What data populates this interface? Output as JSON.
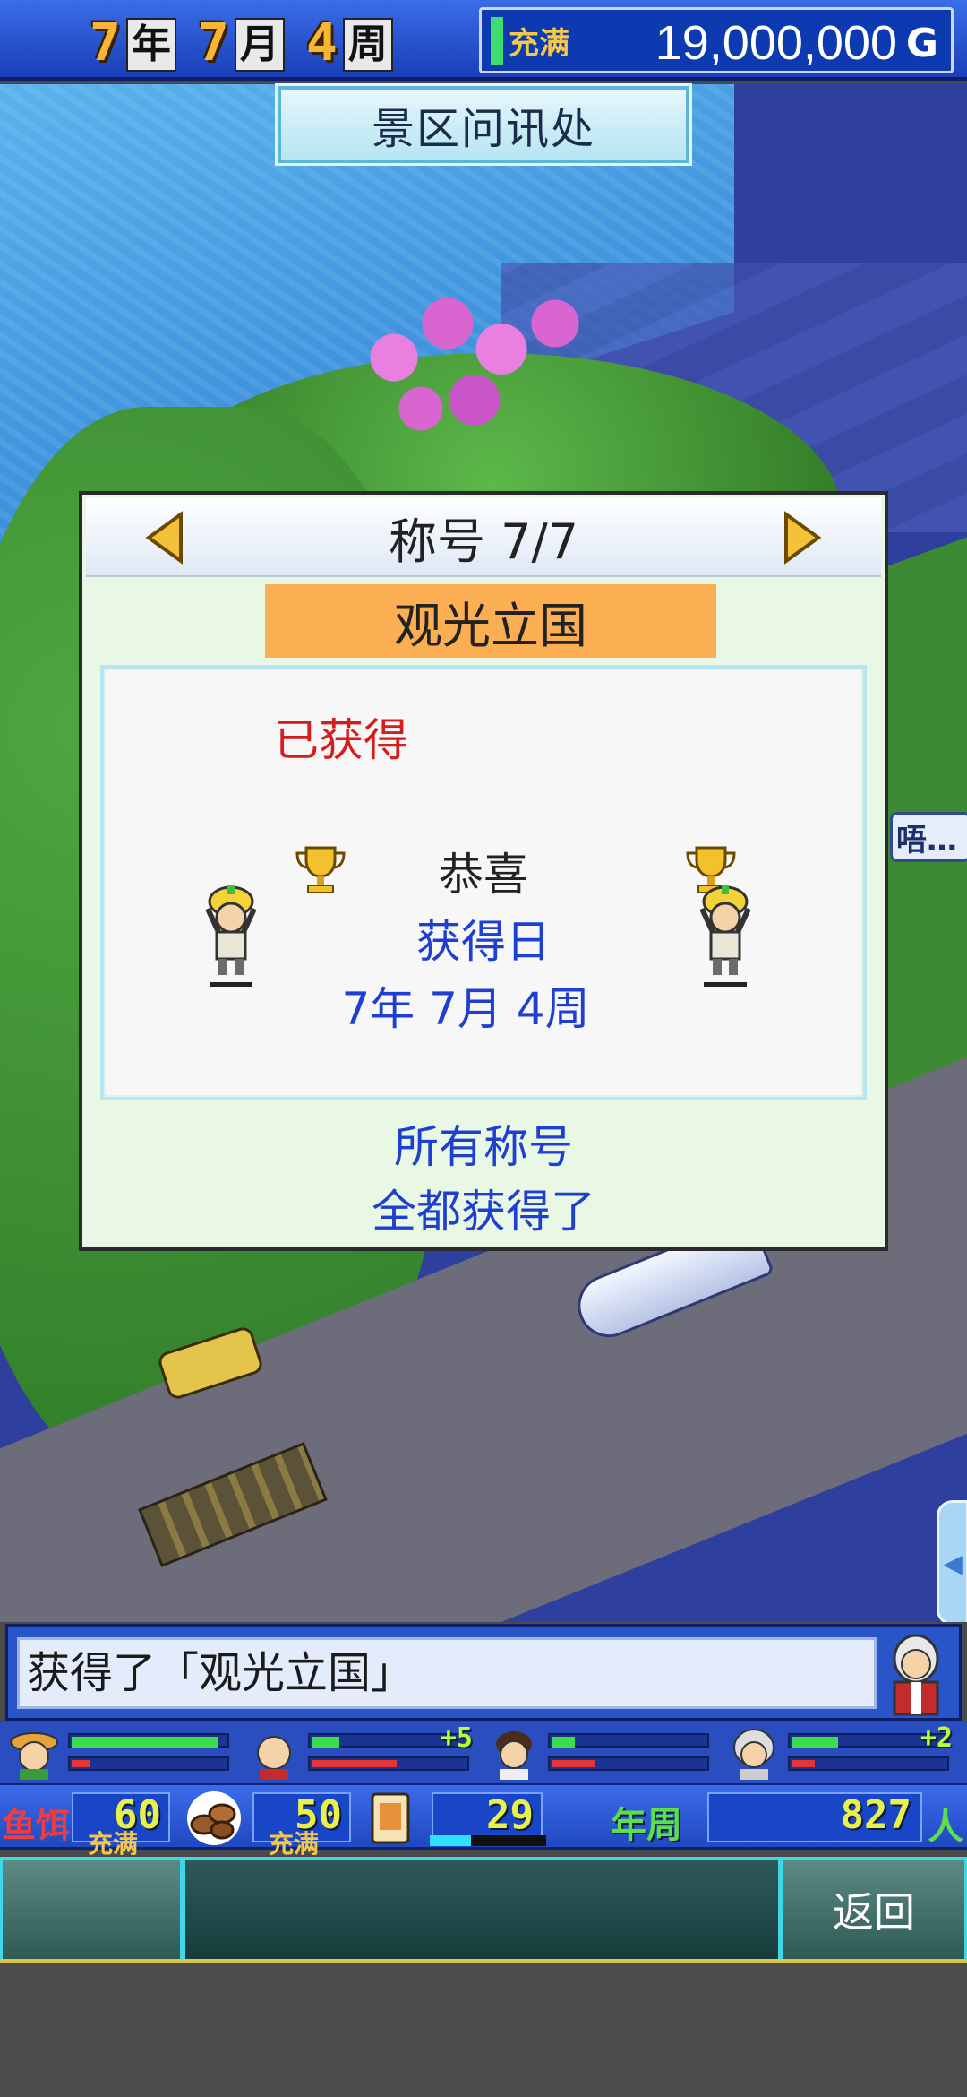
{
  "top_bar": {
    "year_num": "7",
    "year_unit": "年",
    "month_num": "7",
    "month_unit": "月",
    "week_num": "4",
    "week_unit": "周",
    "money_status": "充满",
    "money": "19,000,000",
    "money_unit": "G"
  },
  "banner": {
    "title": "景区问讯处"
  },
  "scene": {
    "talk_bubble": "唔…"
  },
  "dialog": {
    "header": "称号 7/7",
    "title_name": "观光立国",
    "status": "已获得",
    "congrats": "恭喜",
    "date_label": "获得日",
    "date_value": "7年 7月 4周",
    "footer_line1": "所有称号",
    "footer_line2": "全都获得了"
  },
  "message": {
    "text": "获得了「观光立国」"
  },
  "staff": [
    {
      "bonus": "",
      "green": 0.95,
      "red": 0.12
    },
    {
      "bonus": "+5",
      "green": 0.18,
      "red": 0.55
    },
    {
      "bonus": "",
      "green": 0.15,
      "red": 0.28
    },
    {
      "bonus": "+2",
      "green": 0.3,
      "red": 0.15
    }
  ],
  "resources": {
    "label": "鱼饵",
    "food": "60",
    "food_status": "充满",
    "wood": "50",
    "wood_status": "充满",
    "card": "29",
    "card_progress": 0.35,
    "year_label": "年周",
    "year_value": "827",
    "person_icon": "人"
  },
  "menu": {
    "back_label": "返回"
  },
  "colors": {
    "top_bar": "#2a55d6",
    "dialog_bg": "#e8f8e4",
    "title_bg": "#fcae52",
    "status_red": "#d41d1d",
    "text_blue": "#1e3fd0",
    "menu_accent": "#3fd6e8"
  }
}
